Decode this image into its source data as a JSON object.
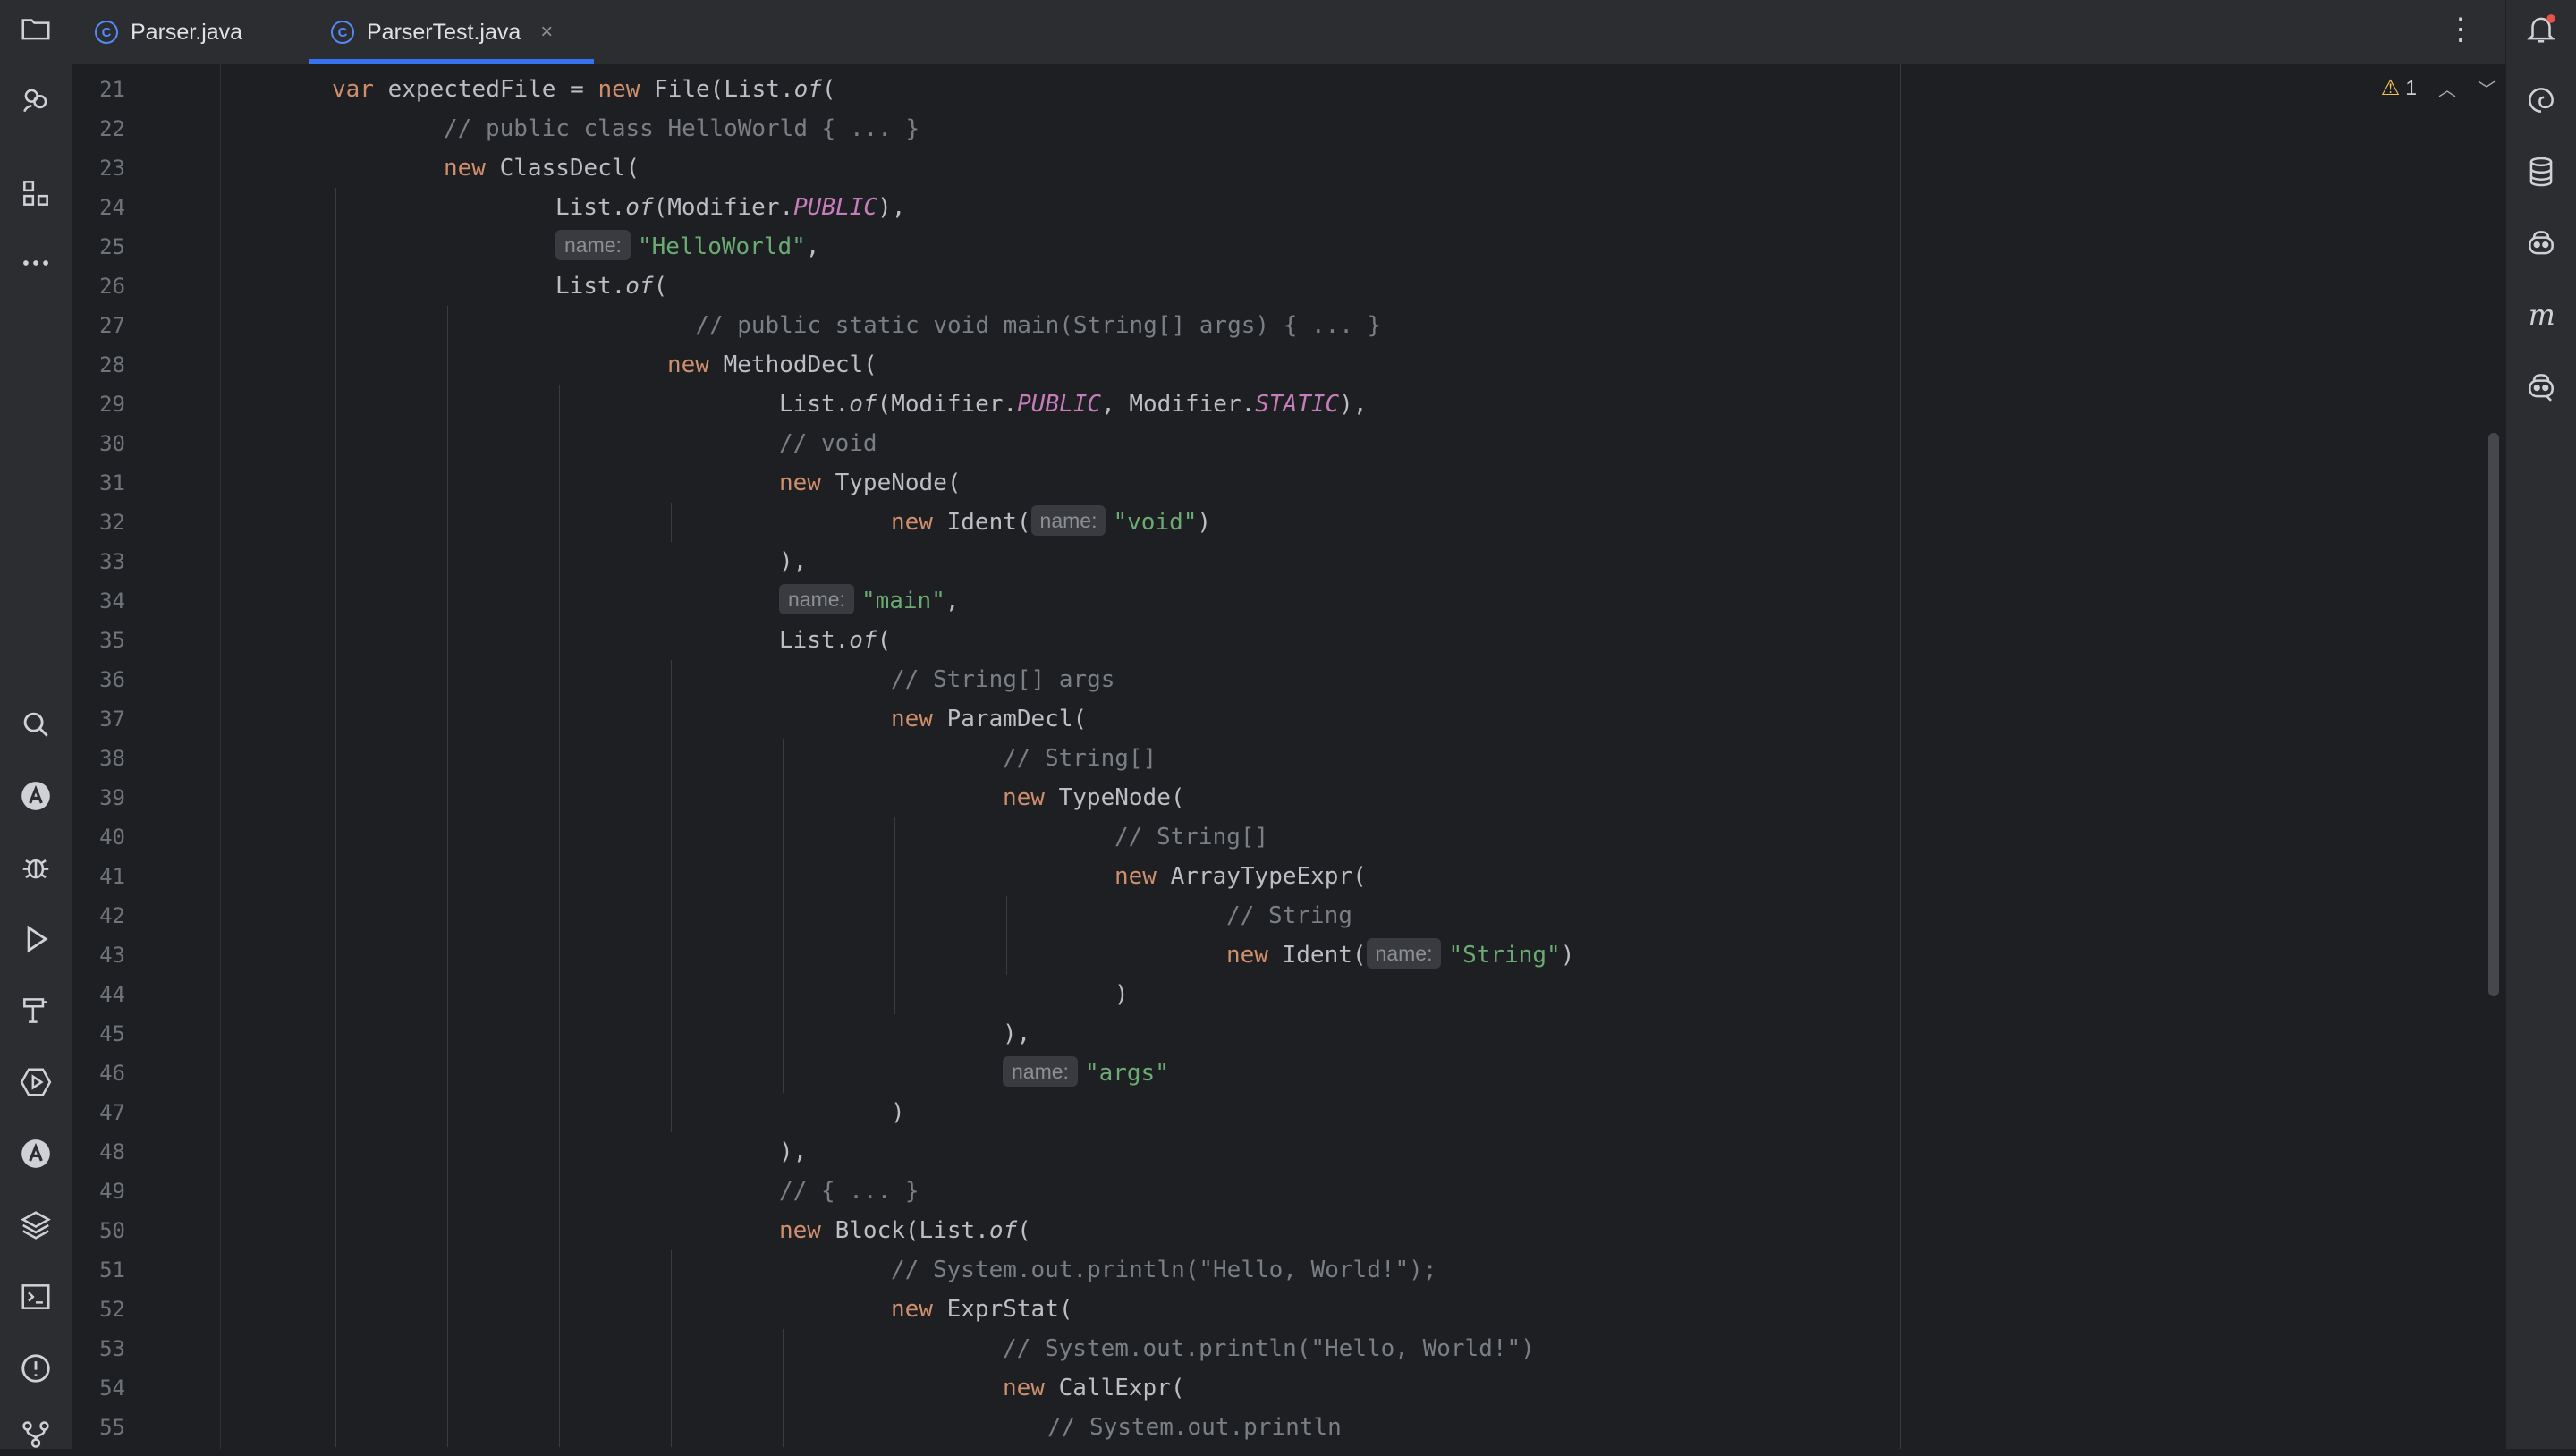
{
  "tabs": [
    {
      "label": "Parser.java",
      "icon": "C"
    },
    {
      "label": "ParserTest.java",
      "icon": "C"
    }
  ],
  "tab_close": "×",
  "more_menu": "⋮",
  "inspection": {
    "warning_icon": "⚠",
    "count": "1",
    "up": "︿",
    "down": "﹀"
  },
  "left_toolbar_top": [
    "project-icon",
    "vcs-commit-icon",
    "structure-icon",
    "more-tools-icon"
  ],
  "left_toolbar_bottom": [
    "search-icon",
    "ai-assistant-icon",
    "debug-icon",
    "run-icon",
    "build-icon",
    "services-icon",
    "ai-chat-icon",
    "layers-icon",
    "terminal-icon",
    "problems-icon",
    "git-icon"
  ],
  "right_toolbar": [
    "notifications-icon",
    "ai-spiral-icon",
    "database-icon",
    "copilot-icon",
    "maven-icon",
    "copilot-chat-icon"
  ],
  "colors": {
    "keyword": "#cf8e6d",
    "string": "#6aab73",
    "comment": "#7a7e85",
    "constant": "#c77dbb",
    "accent": "#3574f0"
  },
  "code_lines": [
    {
      "n": "21",
      "indent": 1,
      "tokens": [
        {
          "t": "var ",
          "k": "kw"
        },
        {
          "t": "expectedFile = "
        },
        {
          "t": "new ",
          "k": "kw"
        },
        {
          "t": "File(List."
        },
        {
          "t": "of",
          "k": "it"
        },
        {
          "t": "("
        }
      ]
    },
    {
      "n": "22",
      "indent": 2,
      "tokens": [
        {
          "t": "// public class HelloWorld { ... }",
          "k": "cmt"
        }
      ]
    },
    {
      "n": "23",
      "indent": 2,
      "tokens": [
        {
          "t": "new ",
          "k": "kw"
        },
        {
          "t": "ClassDecl("
        }
      ]
    },
    {
      "n": "24",
      "indent": 3,
      "tokens": [
        {
          "t": "List."
        },
        {
          "t": "of",
          "k": "it"
        },
        {
          "t": "(Modifier."
        },
        {
          "t": "PUBLIC",
          "k": "const"
        },
        {
          "t": "),"
        }
      ]
    },
    {
      "n": "25",
      "indent": 3,
      "tokens": [
        {
          "t": "name:",
          "k": "hint"
        },
        {
          "t": "\"HelloWorld\"",
          "k": "str"
        },
        {
          "t": ","
        }
      ]
    },
    {
      "n": "26",
      "indent": 3,
      "tokens": [
        {
          "t": "List."
        },
        {
          "t": "of",
          "k": "it"
        },
        {
          "t": "("
        }
      ]
    },
    {
      "n": "27",
      "indent": 4.25,
      "tokens": [
        {
          "t": "// public static void main(String[] args) { ... }",
          "k": "cmt"
        }
      ]
    },
    {
      "n": "28",
      "indent": 4,
      "tokens": [
        {
          "t": "new ",
          "k": "kw"
        },
        {
          "t": "MethodDecl("
        }
      ]
    },
    {
      "n": "29",
      "indent": 5,
      "tokens": [
        {
          "t": "List."
        },
        {
          "t": "of",
          "k": "it"
        },
        {
          "t": "(Modifier."
        },
        {
          "t": "PUBLIC",
          "k": "const"
        },
        {
          "t": ", Modifier."
        },
        {
          "t": "STATIC",
          "k": "const"
        },
        {
          "t": "),"
        }
      ]
    },
    {
      "n": "30",
      "indent": 5,
      "tokens": [
        {
          "t": "// void",
          "k": "cmt"
        }
      ]
    },
    {
      "n": "31",
      "indent": 5,
      "tokens": [
        {
          "t": "new ",
          "k": "kw"
        },
        {
          "t": "TypeNode("
        }
      ]
    },
    {
      "n": "32",
      "indent": 6,
      "tokens": [
        {
          "t": "new ",
          "k": "kw"
        },
        {
          "t": "Ident("
        },
        {
          "t": "name:",
          "k": "hint"
        },
        {
          "t": "\"void\"",
          "k": "str"
        },
        {
          "t": ")"
        }
      ]
    },
    {
      "n": "33",
      "indent": 5,
      "tokens": [
        {
          "t": "),"
        }
      ]
    },
    {
      "n": "34",
      "indent": 5,
      "tokens": [
        {
          "t": "name:",
          "k": "hint"
        },
        {
          "t": "\"main\"",
          "k": "str"
        },
        {
          "t": ","
        }
      ]
    },
    {
      "n": "35",
      "indent": 5,
      "tokens": [
        {
          "t": "List."
        },
        {
          "t": "of",
          "k": "it"
        },
        {
          "t": "("
        }
      ]
    },
    {
      "n": "36",
      "indent": 6,
      "tokens": [
        {
          "t": "// String[] args",
          "k": "cmt"
        }
      ]
    },
    {
      "n": "37",
      "indent": 6,
      "tokens": [
        {
          "t": "new ",
          "k": "kw"
        },
        {
          "t": "ParamDecl("
        }
      ]
    },
    {
      "n": "38",
      "indent": 7,
      "tokens": [
        {
          "t": "// String[]",
          "k": "cmt"
        }
      ]
    },
    {
      "n": "39",
      "indent": 7,
      "tokens": [
        {
          "t": "new ",
          "k": "kw"
        },
        {
          "t": "TypeNode("
        }
      ]
    },
    {
      "n": "40",
      "indent": 8,
      "tokens": [
        {
          "t": "// String[]",
          "k": "cmt"
        }
      ]
    },
    {
      "n": "41",
      "indent": 8,
      "tokens": [
        {
          "t": "new ",
          "k": "kw"
        },
        {
          "t": "ArrayTypeExpr("
        }
      ]
    },
    {
      "n": "42",
      "indent": 9,
      "tokens": [
        {
          "t": "// String",
          "k": "cmt"
        }
      ]
    },
    {
      "n": "43",
      "indent": 9,
      "tokens": [
        {
          "t": "new ",
          "k": "kw"
        },
        {
          "t": "Ident("
        },
        {
          "t": "name:",
          "k": "hint"
        },
        {
          "t": "\"String\"",
          "k": "str"
        },
        {
          "t": ")"
        }
      ]
    },
    {
      "n": "44",
      "indent": 8,
      "tokens": [
        {
          "t": ")"
        }
      ]
    },
    {
      "n": "45",
      "indent": 7,
      "tokens": [
        {
          "t": "),"
        }
      ]
    },
    {
      "n": "46",
      "indent": 7,
      "tokens": [
        {
          "t": "name:",
          "k": "hint"
        },
        {
          "t": "\"args\"",
          "k": "str"
        }
      ]
    },
    {
      "n": "47",
      "indent": 6,
      "tokens": [
        {
          "t": ")"
        }
      ]
    },
    {
      "n": "48",
      "indent": 5,
      "tokens": [
        {
          "t": "),"
        }
      ]
    },
    {
      "n": "49",
      "indent": 5,
      "tokens": [
        {
          "t": "// { ... }",
          "k": "cmt"
        }
      ]
    },
    {
      "n": "50",
      "indent": 5,
      "tokens": [
        {
          "t": "new ",
          "k": "kw"
        },
        {
          "t": "Block(List."
        },
        {
          "t": "of",
          "k": "it"
        },
        {
          "t": "("
        }
      ]
    },
    {
      "n": "51",
      "indent": 6,
      "tokens": [
        {
          "t": "// System.out.println(\"Hello, World!\");",
          "k": "cmt"
        }
      ]
    },
    {
      "n": "52",
      "indent": 6,
      "tokens": [
        {
          "t": "new ",
          "k": "kw"
        },
        {
          "t": "ExprStat("
        }
      ]
    },
    {
      "n": "53",
      "indent": 7,
      "tokens": [
        {
          "t": "// System.out.println(\"Hello, World!\")",
          "k": "cmt"
        }
      ]
    },
    {
      "n": "54",
      "indent": 7,
      "tokens": [
        {
          "t": "new ",
          "k": "kw"
        },
        {
          "t": "CallExpr("
        }
      ]
    },
    {
      "n": "55",
      "indent": 7.4,
      "tokens": [
        {
          "t": "// System.out.println",
          "k": "cmt"
        }
      ]
    }
  ]
}
